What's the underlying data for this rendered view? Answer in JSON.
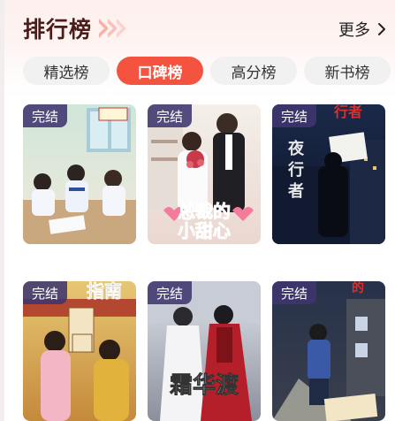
{
  "header": {
    "title": "排行榜",
    "more_label": "更多"
  },
  "tabs": [
    {
      "label": "精选榜",
      "active": false
    },
    {
      "label": "口碑榜",
      "active": true
    },
    {
      "label": "高分榜",
      "active": false
    },
    {
      "label": "新书榜",
      "active": false
    }
  ],
  "books": [
    {
      "badge": "完结",
      "cover_text": ""
    },
    {
      "badge": "完结",
      "cover_text": "总裁的小甜心"
    },
    {
      "badge": "完结",
      "cover_text": "夜行者"
    },
    {
      "badge": "完结",
      "cover_text": "指南"
    },
    {
      "badge": "完结",
      "cover_text": "霜华渡"
    },
    {
      "badge": "完结",
      "cover_text": ""
    }
  ],
  "colors": {
    "accent": "#f4533f",
    "badge_bg": "#3e356e",
    "title": "#4a1d1a"
  }
}
